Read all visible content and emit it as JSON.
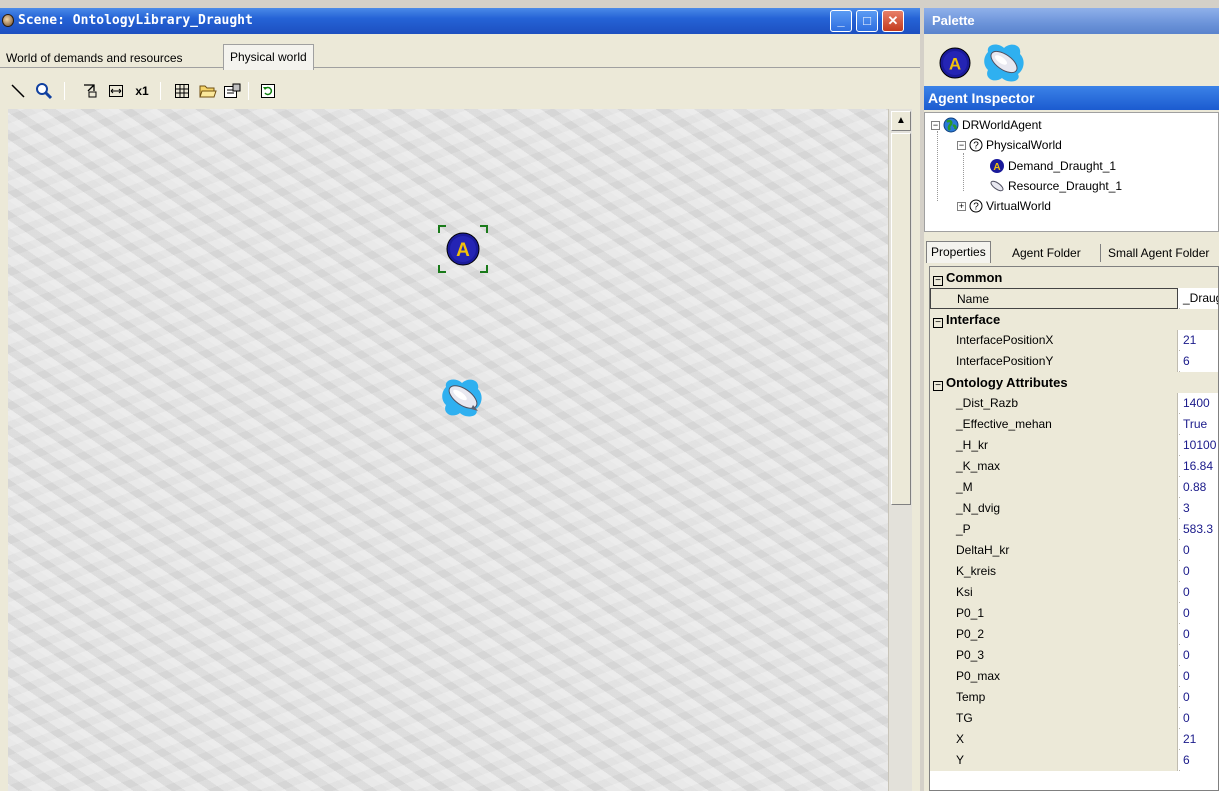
{
  "scene": {
    "title": "Scene: OntologyLibrary_Draught",
    "tabs": [
      "World of demands and resources",
      "Physical world"
    ],
    "toolbar_icons": [
      "line-tool-icon",
      "zoom-icon",
      "fit-icon",
      "fit-width-icon",
      "scale-1x-icon",
      "grid-icon",
      "open-folder-icon",
      "properties-icon",
      "refresh-icon"
    ],
    "scale_label": "x1",
    "demand_icon_letter": "A"
  },
  "palette": {
    "title": "Palette",
    "items": [
      {
        "name": "demand-agent-icon",
        "letter": "A"
      },
      {
        "name": "resource-agent-icon"
      }
    ]
  },
  "inspector": {
    "title": "Agent Inspector",
    "tree": {
      "root": "DRWorldAgent",
      "physical": "PhysicalWorld",
      "demand": "Demand_Draught_1",
      "resource": "Resource_Draught_1",
      "virtual": "VirtualWorld"
    },
    "tabs": [
      "Properties",
      "Agent Folder",
      "Small Agent Folder"
    ],
    "categories": {
      "common": "Common",
      "interface": "Interface",
      "ontology": "Ontology Attributes"
    },
    "common": [
      {
        "name": "Name",
        "value": "_Draught"
      }
    ],
    "interface": [
      {
        "name": "InterfacePositionX",
        "value": "21"
      },
      {
        "name": "InterfacePositionY",
        "value": "6"
      }
    ],
    "ontology": [
      {
        "name": "_Dist_Razb",
        "value": "1400"
      },
      {
        "name": "_Effective_mehan",
        "value": "True"
      },
      {
        "name": "_H_kr",
        "value": "10100"
      },
      {
        "name": "_K_max",
        "value": "16.84"
      },
      {
        "name": "_M",
        "value": "0.88"
      },
      {
        "name": "_N_dvig",
        "value": "3"
      },
      {
        "name": "_P",
        "value": "583.3"
      },
      {
        "name": "DeltaH_kr",
        "value": "0"
      },
      {
        "name": "K_kreis",
        "value": "0"
      },
      {
        "name": "Ksi",
        "value": "0"
      },
      {
        "name": "P0_1",
        "value": "0"
      },
      {
        "name": "P0_2",
        "value": "0"
      },
      {
        "name": "P0_3",
        "value": "0"
      },
      {
        "name": "P0_max",
        "value": "0"
      },
      {
        "name": "Temp",
        "value": "0"
      },
      {
        "name": "TG",
        "value": "0"
      },
      {
        "name": "X",
        "value": "21"
      },
      {
        "name": "Y",
        "value": "6"
      }
    ]
  }
}
